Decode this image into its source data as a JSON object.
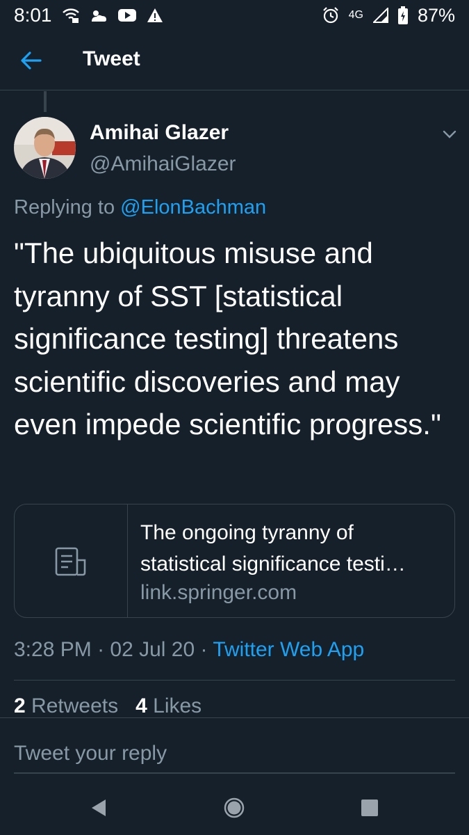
{
  "status_bar": {
    "time": "8:01",
    "network": "4G",
    "battery": "87%",
    "left_icons": [
      "wifi-calling-icon",
      "weather-icon",
      "youtube-icon",
      "warning-icon"
    ],
    "right_icons": [
      "alarm-icon",
      "signal-icon",
      "battery-icon"
    ]
  },
  "header": {
    "title": "Tweet",
    "back_icon": "arrow-left-icon"
  },
  "tweet": {
    "author_name": "Amihai Glazer",
    "author_handle": "@AmihaiGlazer",
    "replying_prefix": "Replying to",
    "replying_to": "@ElonBachman",
    "text": "\"The ubiquitous misuse and tyranny of SST [statistical significance testing] threatens scientific discoveries and may even impede scientific progress.\"",
    "card": {
      "title_line1": "The ongoing tyranny of",
      "title_line2": "statistical significance testi…",
      "domain": "link.springer.com",
      "thumb_icon": "document-icon"
    },
    "time": "3:28 PM",
    "date": "02 Jul 20",
    "separator": "·",
    "source": "Twitter Web App",
    "retweets_count": "2",
    "retweets_label": "Retweets",
    "likes_count": "4",
    "likes_label": "Likes"
  },
  "reply": {
    "placeholder": "Tweet your reply"
  },
  "nav": {
    "icons": [
      "back-triangle-icon",
      "home-circle-icon",
      "recents-square-icon"
    ]
  },
  "colors": {
    "background": "#15202b",
    "accent": "#1da1f2",
    "secondary_text": "#8899a6",
    "border": "#38444d"
  }
}
